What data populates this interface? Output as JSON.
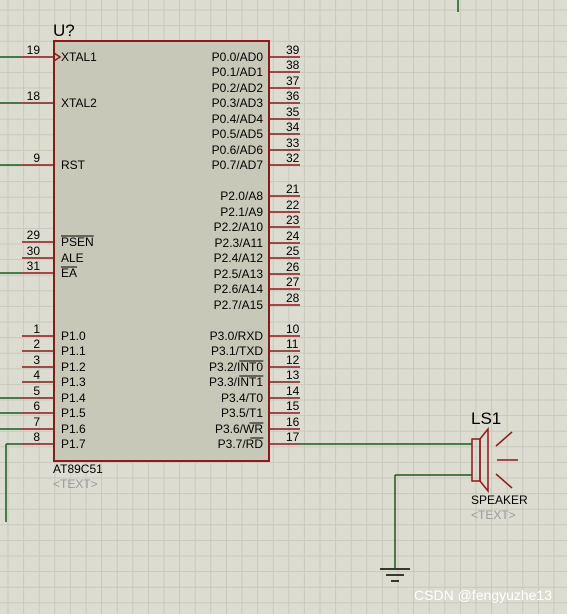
{
  "colors": {
    "background": "#dcdcd0",
    "grid": "#c8c8bc",
    "chip_fill": "#c8c8b8",
    "chip_border": "#8b1a1a",
    "pin": "#8b1a1a",
    "wire": "#1a5a1a",
    "text": "#000000",
    "placeholder_text": "#9a9a9a",
    "watermark": "#ffffff"
  },
  "chip": {
    "ref": "U?",
    "part": "AT89C51",
    "text_placeholder": "<TEXT>",
    "left_pins": [
      {
        "num": "19",
        "name": "XTAL1",
        "clock": true
      },
      {
        "num": "18",
        "name": "XTAL2"
      },
      {
        "num": "9",
        "name": "RST"
      },
      {
        "num": "29",
        "name": "PSEN",
        "overbar": "PSEN"
      },
      {
        "num": "30",
        "name": "ALE"
      },
      {
        "num": "31",
        "name": "EA",
        "overbar": "EA"
      },
      {
        "num": "1",
        "name": "P1.0"
      },
      {
        "num": "2",
        "name": "P1.1"
      },
      {
        "num": "3",
        "name": "P1.2"
      },
      {
        "num": "4",
        "name": "P1.3"
      },
      {
        "num": "5",
        "name": "P1.4"
      },
      {
        "num": "6",
        "name": "P1.5"
      },
      {
        "num": "7",
        "name": "P1.6"
      },
      {
        "num": "8",
        "name": "P1.7"
      }
    ],
    "right_pins": [
      {
        "num": "39",
        "name": "P0.0/AD0"
      },
      {
        "num": "38",
        "name": "P0.1/AD1"
      },
      {
        "num": "37",
        "name": "P0.2/AD2"
      },
      {
        "num": "36",
        "name": "P0.3/AD3"
      },
      {
        "num": "35",
        "name": "P0.4/AD4"
      },
      {
        "num": "34",
        "name": "P0.5/AD5"
      },
      {
        "num": "33",
        "name": "P0.6/AD6"
      },
      {
        "num": "32",
        "name": "P0.7/AD7"
      },
      {
        "num": "21",
        "name": "P2.0/A8"
      },
      {
        "num": "22",
        "name": "P2.1/A9"
      },
      {
        "num": "23",
        "name": "P2.2/A10"
      },
      {
        "num": "24",
        "name": "P2.3/A11"
      },
      {
        "num": "25",
        "name": "P2.4/A12"
      },
      {
        "num": "26",
        "name": "P2.5/A13"
      },
      {
        "num": "27",
        "name": "P2.6/A14"
      },
      {
        "num": "28",
        "name": "P2.7/A15"
      },
      {
        "num": "10",
        "name": "P3.0/RXD"
      },
      {
        "num": "11",
        "name": "P3.1/TXD"
      },
      {
        "num": "12",
        "name": "P3.2/INT0",
        "overbar": "INT0"
      },
      {
        "num": "13",
        "name": "P3.3/INT1",
        "overbar": "INT1"
      },
      {
        "num": "14",
        "name": "P3.4/T0"
      },
      {
        "num": "15",
        "name": "P3.5/T1"
      },
      {
        "num": "16",
        "name": "P3.6/WR",
        "overbar": "WR"
      },
      {
        "num": "17",
        "name": "P3.7/RD",
        "overbar": "RD"
      }
    ]
  },
  "speaker": {
    "ref": "LS1",
    "part": "SPEAKER",
    "text_placeholder": "<TEXT>"
  },
  "watermark": "CSDN @fengyuzhe13"
}
